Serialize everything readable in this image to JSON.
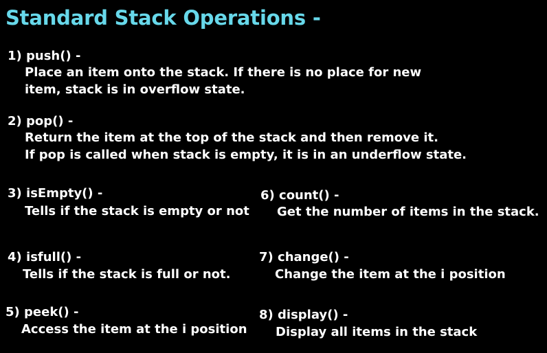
{
  "title": "Standard Stack Operations -",
  "ops": {
    "push": {
      "heading": "1) push() -",
      "lines": [
        "Place an item onto the stack. If there is no place for new",
        "item, stack is in overflow state."
      ]
    },
    "pop": {
      "heading": "2) pop() -",
      "lines": [
        "Return the item at the top of the stack and then remove it.",
        "If pop is called when stack is empty, it is in an underflow state."
      ]
    },
    "isEmpty": {
      "heading": "3) isEmpty() -",
      "lines": [
        "Tells if the stack is empty or not"
      ]
    },
    "isfull": {
      "heading": "4) isfull() -",
      "lines": [
        "Tells if the stack is full or not."
      ]
    },
    "peek": {
      "heading": "5) peek() -",
      "lines": [
        "Access the item at the i position"
      ]
    },
    "count": {
      "heading": "6) count() -",
      "lines": [
        "Get the number of items in the stack."
      ]
    },
    "change": {
      "heading": "7) change() -",
      "lines": [
        "Change the item at the i position"
      ]
    },
    "display": {
      "heading": "8) display() -",
      "lines": [
        "Display all items in the stack"
      ]
    }
  },
  "colors": {
    "background": "#000000",
    "title": "#67d8ea",
    "text": "#ffffff"
  }
}
